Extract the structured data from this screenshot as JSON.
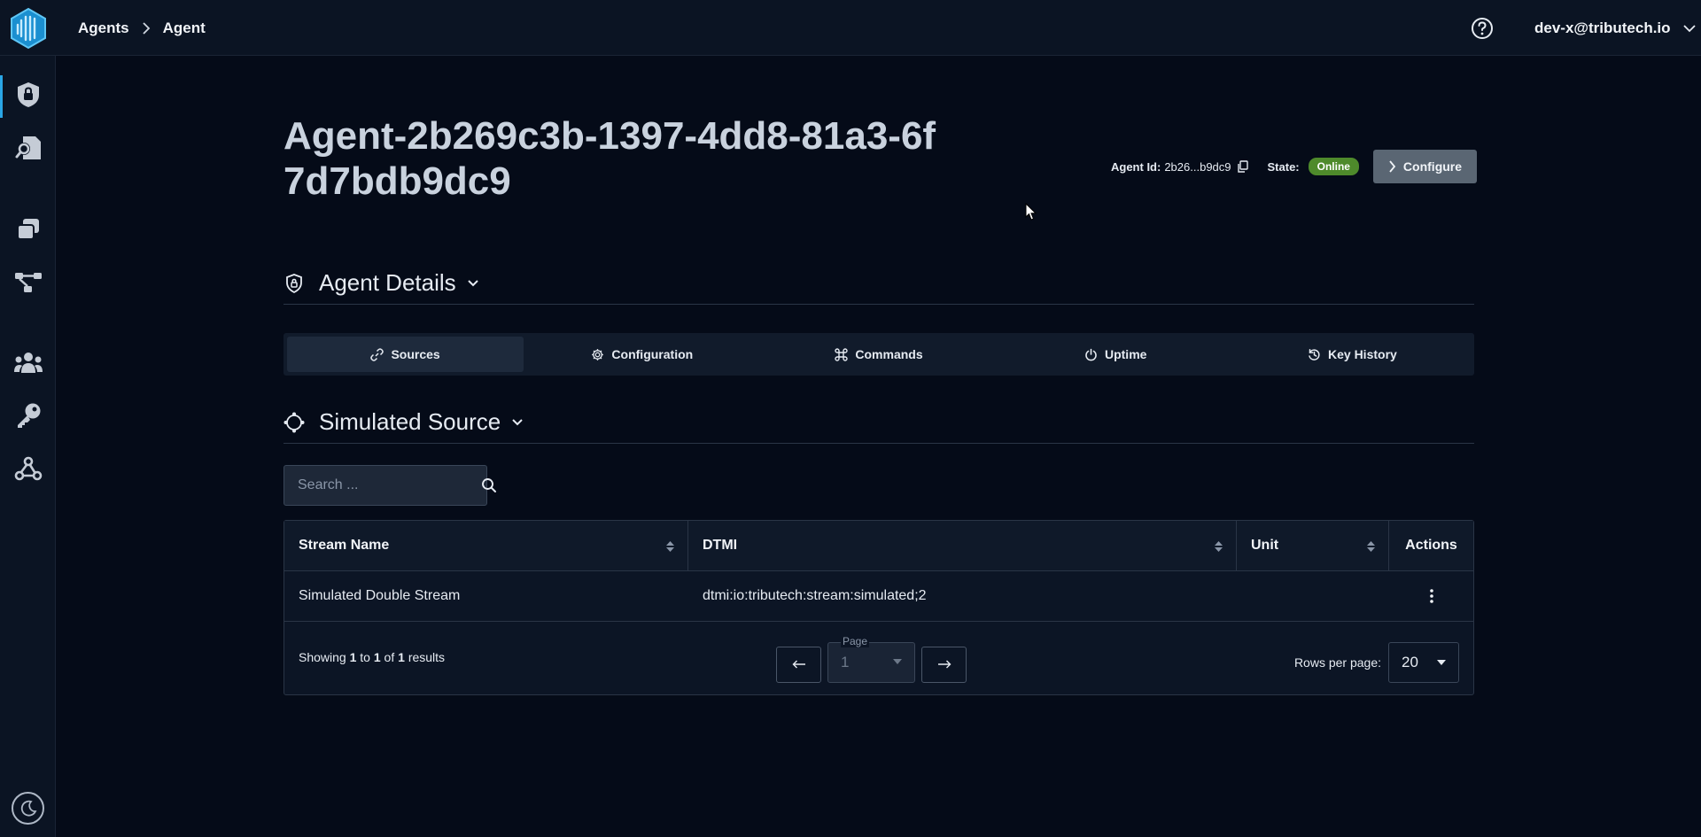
{
  "breadcrumb": {
    "items": [
      "Agents",
      "Agent"
    ]
  },
  "user": {
    "email": "dev-x@tributech.io"
  },
  "agent": {
    "title": "Agent-2b269c3b-1397-4dd8-81a3-6f7d7bdb9dc9",
    "id_label": "Agent Id:",
    "id_short": "2b26...b9dc9",
    "state_label": "State:",
    "state_value": "Online",
    "configure_label": "Configure"
  },
  "details_section": {
    "title": "Agent Details"
  },
  "tabs": [
    {
      "label": "Sources",
      "icon": "link-icon",
      "active": true
    },
    {
      "label": "Configuration",
      "icon": "gear-icon",
      "active": false
    },
    {
      "label": "Commands",
      "icon": "command-icon",
      "active": false
    },
    {
      "label": "Uptime",
      "icon": "power-icon",
      "active": false
    },
    {
      "label": "Key History",
      "icon": "history-icon",
      "active": false
    }
  ],
  "source_section": {
    "title": "Simulated Source"
  },
  "search": {
    "placeholder": "Search ..."
  },
  "table": {
    "columns": [
      "Stream Name",
      "DTMI",
      "Unit",
      "Actions"
    ],
    "rows": [
      {
        "stream_name": "Simulated Double Stream",
        "dtmi": "dtmi:io:tributech:stream:simulated;2",
        "unit": ""
      }
    ]
  },
  "pagination": {
    "showing_prefix": "Showing",
    "from": "1",
    "to_word": "to",
    "to": "1",
    "of_word": "of",
    "total": "1",
    "results_word": "results",
    "page_legend": "Page",
    "page_value": "1",
    "rows_per_page_label": "Rows per page:",
    "rows_per_page_value": "20"
  },
  "colors": {
    "accent": "#2aa6e6",
    "online": "#4e8a2b",
    "background": "#050b18",
    "panel": "#0b1423"
  }
}
